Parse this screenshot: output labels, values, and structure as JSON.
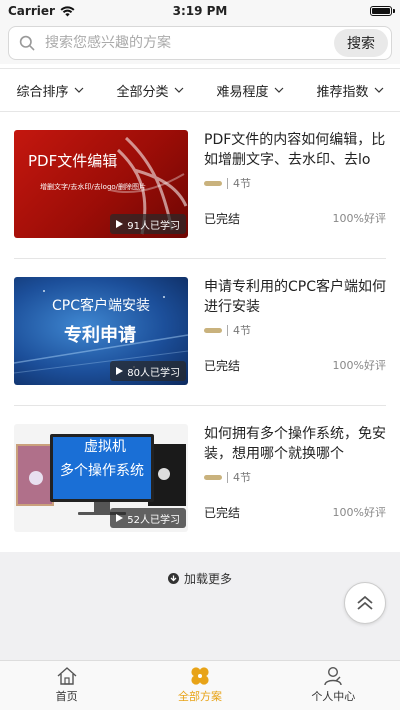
{
  "status_bar": {
    "carrier": "Carrier",
    "time": "3:19 PM"
  },
  "search": {
    "placeholder": "搜索您感兴趣的方案",
    "value": "",
    "button_label": "搜索"
  },
  "filters": [
    {
      "label": "综合排序"
    },
    {
      "label": "全部分类"
    },
    {
      "label": "难易程度"
    },
    {
      "label": "推荐指数"
    }
  ],
  "courses": [
    {
      "title": "PDF文件的内容如何编辑，比如增删文字、去水印、去log...",
      "thumb_title": "PDF文件编辑",
      "thumb_subtitle": "增删文字/去水印/去logo/删除图片",
      "learned": "91人已学习",
      "lessons": "4节",
      "status": "已完结",
      "rating": "100%好评"
    },
    {
      "title": "申请专利用的CPC客户端如何进行安装",
      "thumb_title": "CPC客户端安装",
      "thumb_subtitle": "专利申请",
      "learned": "80人已学习",
      "lessons": "4节",
      "status": "已完结",
      "rating": "100%好评"
    },
    {
      "title": "如何拥有多个操作系统，免安装，想用哪个就换哪个",
      "thumb_title": "虚拟机",
      "thumb_subtitle": "多个操作系统",
      "learned": "52人已学习",
      "lessons": "4节",
      "status": "已完结",
      "rating": "100%好评"
    }
  ],
  "load_more": "加载更多",
  "tabs": [
    {
      "label": "首页",
      "icon": "home-icon"
    },
    {
      "label": "全部方案",
      "icon": "clover-icon",
      "active": true
    },
    {
      "label": "个人中心",
      "icon": "user-icon"
    }
  ],
  "colors": {
    "accent": "#e8a317",
    "pdf_red": "#b3120d",
    "cpc_blue": "#1c4f9a",
    "level_pill": "#c9b27d"
  }
}
